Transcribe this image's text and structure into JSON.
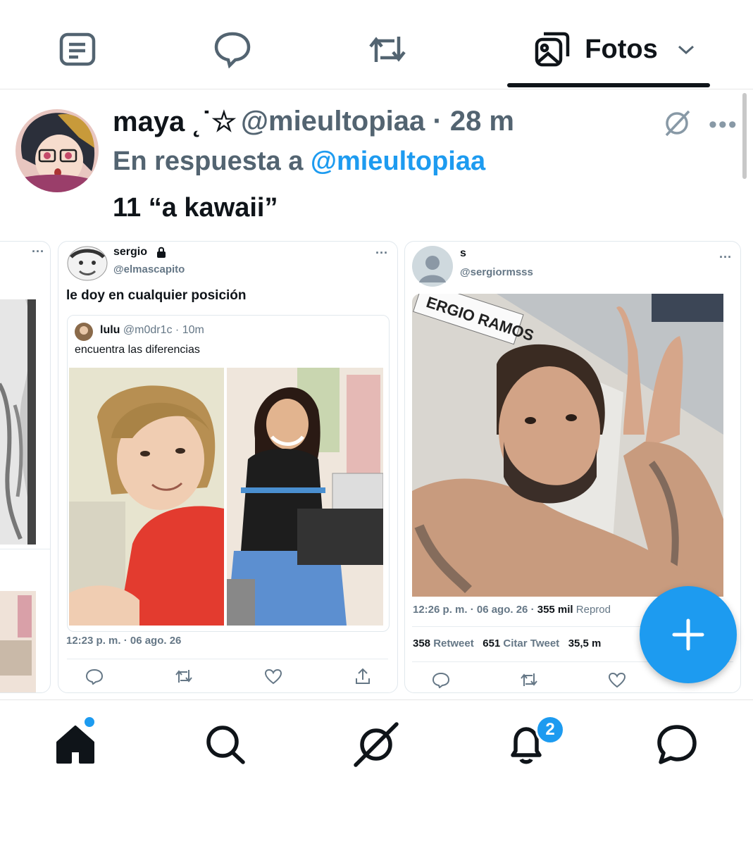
{
  "tabs": {
    "fotos_label": "Fotos"
  },
  "tweet": {
    "name": "maya ˛˙☆",
    "handle_time": "@mieultopiaa · 28 m",
    "reply_prefix": "En respuesta a ",
    "reply_handle": "@mieultopiaa",
    "text": "11 “a kawaii”"
  },
  "card1": {
    "name": "sergio",
    "handle": "@elmascapito",
    "text": "le doy en cualquier posición",
    "quote": {
      "name": "lulu",
      "handle_time": "@m0dr1c · 10m",
      "text": "encuentra las diferencias"
    },
    "meta": "12:23 p. m. · 06 ago. 26"
  },
  "card2": {
    "name": "s",
    "handle": "@sergiormsss",
    "photo_text": "ERGIO RAMOS",
    "meta_time": "12:26 p. m. · 06 ago. 26 · ",
    "meta_views": "355 mil",
    "meta_views_suffix": " Reprod",
    "retweets_count": "358",
    "retweets_label": " Retweet",
    "quotes_count": "651",
    "quotes_label": " Citar Tweet",
    "likes_count": "35,5 m"
  },
  "bottom_nav": {
    "notifications_badge": "2"
  },
  "colors": {
    "accent": "#1d9bf0",
    "text": "#0f1419",
    "muted": "#536471"
  },
  "icons": [
    "article-icon",
    "reply-icon",
    "retweet-icon",
    "photos-icon",
    "chevron-down-icon",
    "grok-icon",
    "more-icon",
    "home-icon",
    "search-icon",
    "notifications-icon",
    "messages-icon",
    "plus-icon"
  ]
}
